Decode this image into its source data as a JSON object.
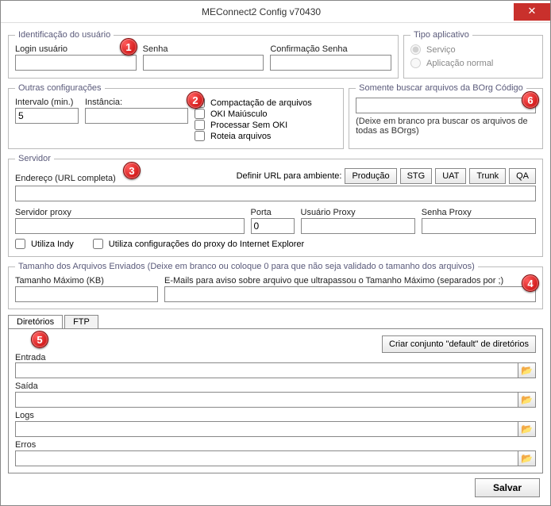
{
  "window": {
    "title": "MEConnect2 Config v70430"
  },
  "ident": {
    "legend": "Identificação do usuário",
    "login_label": "Login usuário",
    "login_value": "",
    "senha_label": "Senha",
    "senha_value": "",
    "confirma_label": "Confirmação Senha",
    "confirma_value": ""
  },
  "tipo": {
    "legend": "Tipo aplicativo",
    "servico_label": "Serviço",
    "app_normal_label": "Aplicação normal"
  },
  "outras": {
    "legend": "Outras configurações",
    "intervalo_label": "Intervalo (min.)",
    "intervalo_value": "5",
    "instancia_label": "Instância:",
    "instancia_value": "",
    "chk_compact": "Compactação de arquivos",
    "chk_oki_maius": "OKI Maiúsculo",
    "chk_proc_sem_oki": "Processar Sem OKI",
    "chk_roteia": "Roteia arquivos"
  },
  "borg": {
    "legend": "Somente buscar arquivos da BOrg Código",
    "value": "",
    "hint": "(Deixe em branco pra buscar os arquivos de todas as BOrgs)"
  },
  "servidor": {
    "legend": "Servidor",
    "endereco_label": "Endereço (URL completa)",
    "endereco_value": "",
    "definir_label": "Definir URL para ambiente:",
    "btn_producao": "Produção",
    "btn_stg": "STG",
    "btn_uat": "UAT",
    "btn_trunk": "Trunk",
    "btn_qa": "QA",
    "proxy_label": "Servidor proxy",
    "proxy_value": "",
    "porta_label": "Porta",
    "porta_value": "0",
    "usuario_proxy_label": "Usuário Proxy",
    "usuario_proxy_value": "",
    "senha_proxy_label": "Senha Proxy",
    "senha_proxy_value": "",
    "chk_indy": "Utiliza Indy",
    "chk_ie_proxy": "Utiliza configurações do proxy do Internet Explorer"
  },
  "tamanho": {
    "legend": "Tamanho dos Arquivos Enviados (Deixe em branco ou coloque 0 para que não seja validado o tamanho dos arquivos)",
    "tam_max_label": "Tamanho Máximo (KB)",
    "tam_max_value": "",
    "emails_label": "E-Mails para aviso sobre arquivo que ultrapassou o Tamanho Máximo (separados por ;)",
    "emails_value": ""
  },
  "tabs": {
    "diretorios": "Diretórios",
    "ftp": "FTP"
  },
  "dirs": {
    "criar_default_btn": "Criar conjunto \"default\" de diretórios",
    "entrada_label": "Entrada",
    "entrada_value": "",
    "saida_label": "Saída",
    "saida_value": "",
    "logs_label": "Logs",
    "logs_value": "",
    "erros_label": "Erros",
    "erros_value": ""
  },
  "badges": {
    "b1": "1",
    "b2": "2",
    "b3": "3",
    "b4": "4",
    "b5": "5",
    "b6": "6"
  },
  "bottom": {
    "salvar": "Salvar"
  }
}
